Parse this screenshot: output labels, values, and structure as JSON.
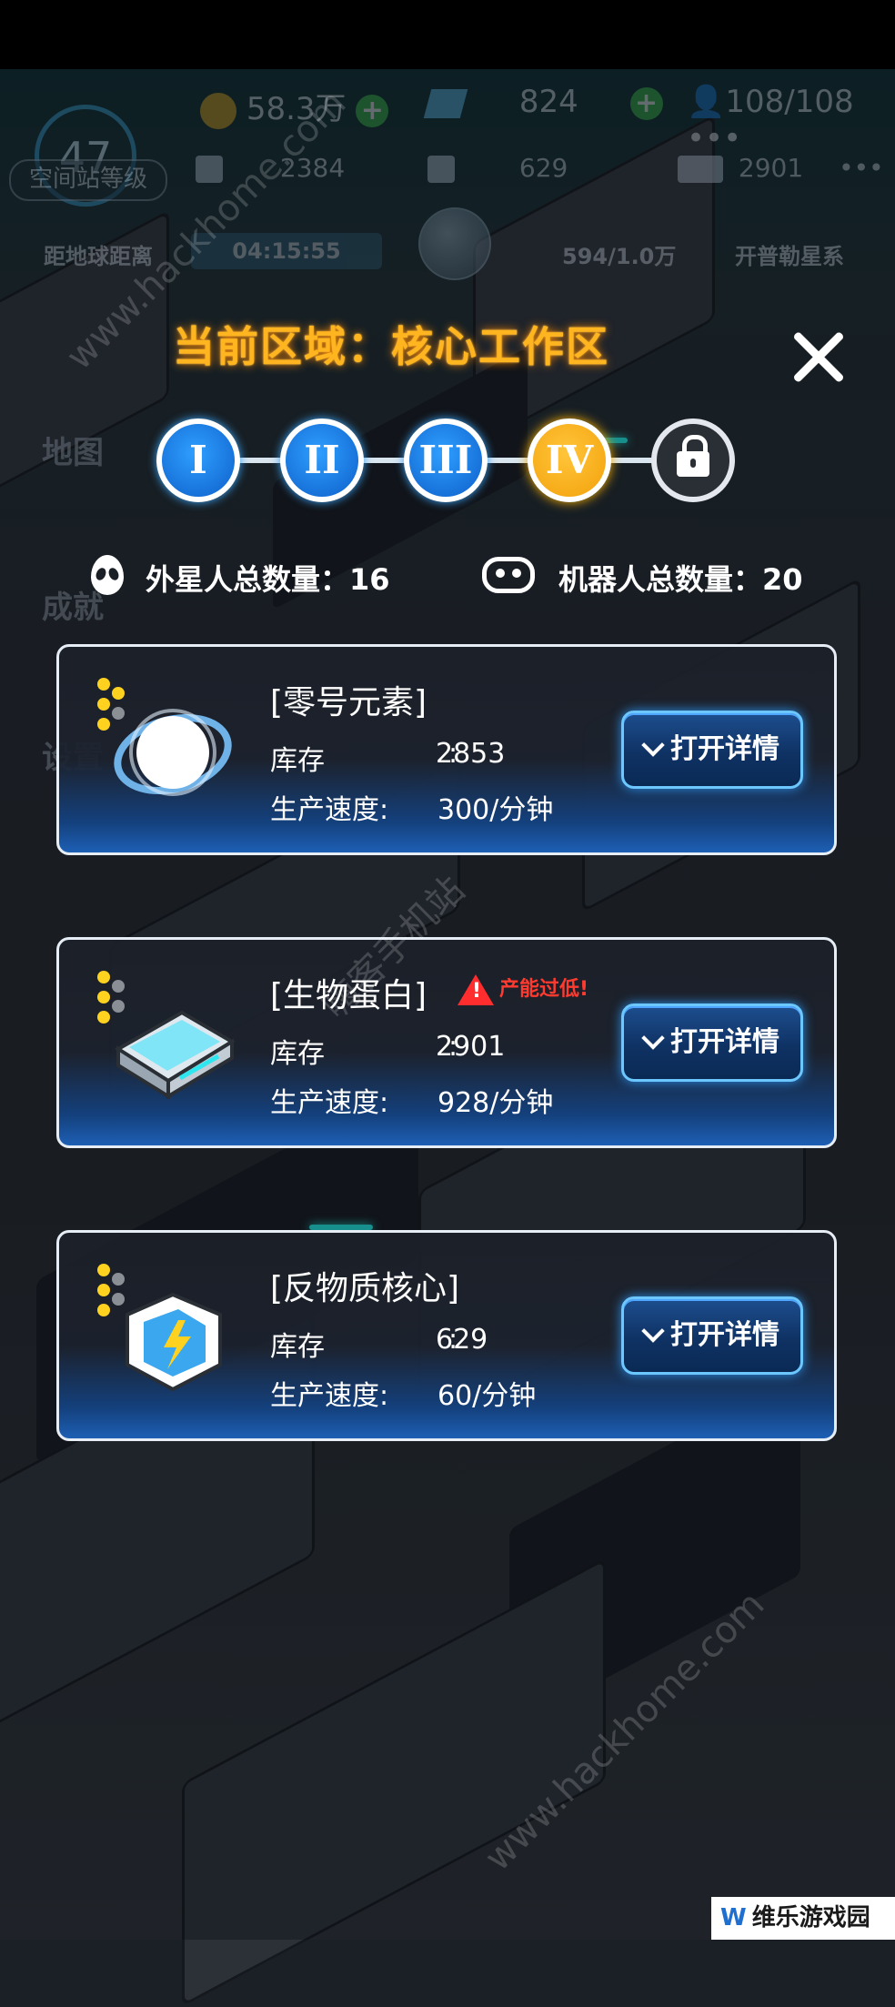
{
  "hud": {
    "level": "47",
    "level_label": "空间站等级",
    "gold": "58.3万",
    "gems": "824",
    "population": "108/108",
    "res1": "2384",
    "res2": "629",
    "res3": "2901",
    "distance_label": "距地球距离",
    "timer": "04:15:55",
    "progress": "594/1.0万",
    "planet_name": "开普勒星系",
    "side_map": "地图",
    "side_achievements": "成就",
    "side_settings": "设置",
    "more": "•••"
  },
  "panel": {
    "title": "当前区域：核心工作区",
    "stages": [
      "I",
      "II",
      "III",
      "IV"
    ],
    "active_stage": "IV",
    "alien_count_label": "外星人总数量：16",
    "robot_count_label": "机器人总数量：20"
  },
  "items": [
    {
      "name": "[零号元素]",
      "stock_label": "库存",
      "colon": ":",
      "stock": "2853",
      "rate_label": "生产速度:",
      "rate": "300/分钟",
      "button": "打开详情",
      "icon": "zero-element-orb-icon"
    },
    {
      "name": "[生物蛋白]",
      "warning": "产能过低!",
      "stock_label": "库存",
      "colon": ":",
      "stock": "2901",
      "rate_label": "生产速度:",
      "rate": "928/分钟",
      "button": "打开详情",
      "icon": "bio-protein-tray-icon"
    },
    {
      "name": "[反物质核心]",
      "stock_label": "库存",
      "colon": ":",
      "stock": "629",
      "rate_label": "生产速度:",
      "rate": "60/分钟",
      "button": "打开详情",
      "icon": "antimatter-core-cube-icon"
    }
  ],
  "watermarks": [
    "www.hackhome.com",
    "嗨客手机站",
    "www.hackhome.com"
  ],
  "brand": {
    "logo": "W",
    "text": "维乐游戏园"
  },
  "colors": {
    "accent_orange": "#ffb51f",
    "button_blue": "#1d4e8e",
    "active_stage": "#f3a10b",
    "warning_red": "#ff3b30"
  }
}
